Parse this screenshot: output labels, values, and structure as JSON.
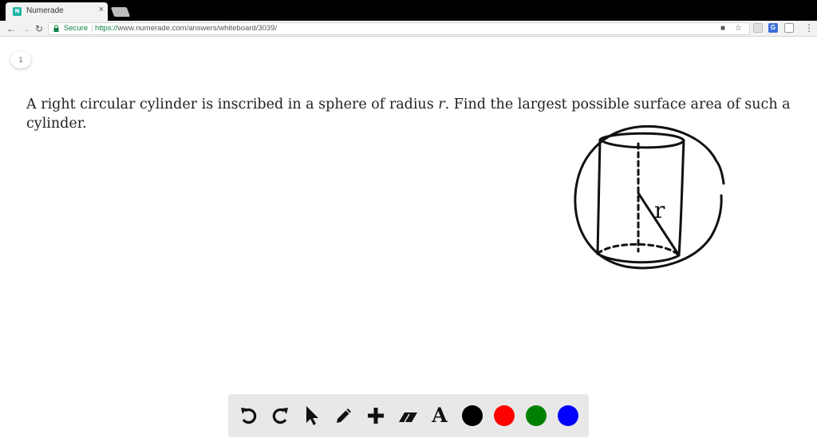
{
  "browser": {
    "tab_title": "Numerade",
    "tab_favicon_text": "N",
    "tab_close": "×",
    "secure_label": "Secure",
    "url_protocol": "https://",
    "url_rest": "www.numerade.com/answers/whiteboard/3039/",
    "extension_g": "G"
  },
  "page": {
    "page_number": "1",
    "question_before": "A right circular cylinder is inscribed in a sphere of radius ",
    "question_variable": "r",
    "question_after": ". Find the largest possible surface area of such a cylinder.",
    "sketch_label": "r"
  },
  "toolbar": {
    "tools": [
      "undo",
      "redo",
      "select",
      "pen",
      "add",
      "eraser",
      "text"
    ],
    "text_tool_label": "A",
    "colors": [
      "#000000",
      "#ff0000",
      "#008000",
      "#0000ff"
    ]
  }
}
